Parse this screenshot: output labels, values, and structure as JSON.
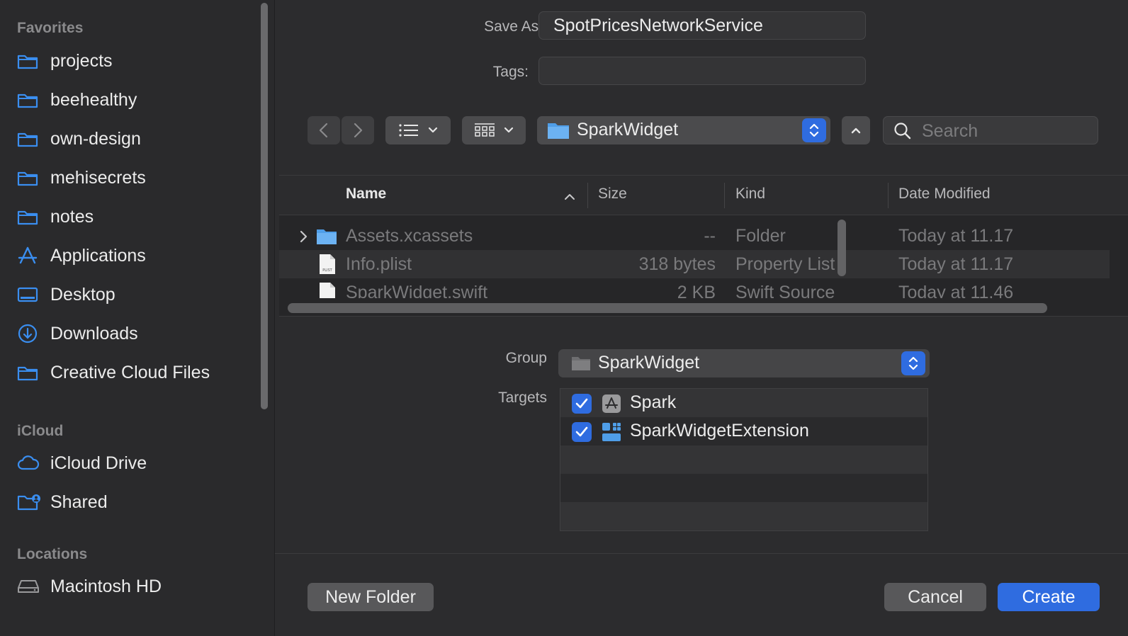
{
  "sidebar": {
    "sections": [
      {
        "title": "Favorites"
      },
      {
        "title": "iCloud"
      },
      {
        "title": "Locations"
      }
    ],
    "favorites": [
      {
        "label": "projects",
        "icon": "folder-icon"
      },
      {
        "label": "beehealthy",
        "icon": "folder-icon"
      },
      {
        "label": "own-design",
        "icon": "folder-icon"
      },
      {
        "label": "mehisecrets",
        "icon": "folder-icon"
      },
      {
        "label": "notes",
        "icon": "folder-icon"
      },
      {
        "label": "Applications",
        "icon": "applications-icon"
      },
      {
        "label": "Desktop",
        "icon": "desktop-icon"
      },
      {
        "label": "Downloads",
        "icon": "downloads-icon"
      },
      {
        "label": "Creative Cloud Files",
        "icon": "folder-icon"
      }
    ],
    "icloud": [
      {
        "label": "iCloud Drive",
        "icon": "cloud-icon"
      },
      {
        "label": "Shared",
        "icon": "shared-folder-icon"
      }
    ],
    "locations": [
      {
        "label": "Macintosh HD",
        "icon": "disk-icon"
      }
    ]
  },
  "form": {
    "save_as_label": "Save As:",
    "save_as_value": "SpotPricesNetworkService",
    "tags_label": "Tags:",
    "tags_value": ""
  },
  "toolbar": {
    "path_popup": "SparkWidget",
    "search_placeholder": "Search"
  },
  "file_list": {
    "columns": [
      "Name",
      "Size",
      "Kind",
      "Date Modified"
    ],
    "rows": [
      {
        "name": "Assets.xcassets",
        "size": "--",
        "kind": "Folder",
        "date": "Today at 11.17",
        "icon": "folder-icon"
      },
      {
        "name": "Info.plist",
        "size": "318 bytes",
        "kind": "Property List",
        "date": "Today at 11.17",
        "icon": "plist-file-icon"
      },
      {
        "name": "SparkWidget.swift",
        "size": "2 KB",
        "kind": "Swift Source",
        "date": "Today at 11.46",
        "icon": "swift-file-icon"
      }
    ]
  },
  "group": {
    "label": "Group",
    "value": "SparkWidget"
  },
  "targets": {
    "label": "Targets",
    "items": [
      {
        "label": "Spark",
        "checked": true,
        "icon": "app-store-icon"
      },
      {
        "label": "SparkWidgetExtension",
        "checked": true,
        "icon": "widget-extension-icon"
      }
    ]
  },
  "buttons": {
    "new_folder": "New Folder",
    "cancel": "Cancel",
    "create": "Create"
  },
  "colors": {
    "accent": "#2f6ce0",
    "sidebar_icon": "#3a8ef0"
  }
}
